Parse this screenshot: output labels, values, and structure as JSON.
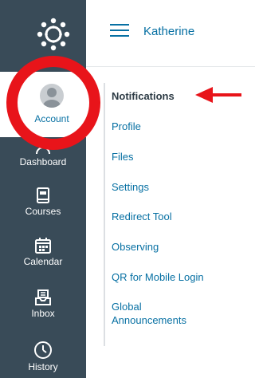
{
  "header": {
    "user_name": "Katherine"
  },
  "global_nav": {
    "account_label": "Account",
    "items": [
      {
        "label": "Dashboard",
        "icon": "dashboard-icon"
      },
      {
        "label": "Courses",
        "icon": "book-icon"
      },
      {
        "label": "Calendar",
        "icon": "calendar-icon"
      },
      {
        "label": "Inbox",
        "icon": "inbox-icon"
      },
      {
        "label": "History",
        "icon": "clock-icon"
      }
    ]
  },
  "account_menu": {
    "items": [
      {
        "label": "Notifications",
        "active": true
      },
      {
        "label": "Profile"
      },
      {
        "label": "Files"
      },
      {
        "label": "Settings"
      },
      {
        "label": "Redirect Tool"
      },
      {
        "label": "Observing"
      },
      {
        "label": "QR for Mobile Login"
      },
      {
        "label": "Global Announcements"
      }
    ]
  },
  "colors": {
    "nav_bg": "#394b58",
    "link": "#0770a3",
    "annotation_red": "#e8141a"
  }
}
